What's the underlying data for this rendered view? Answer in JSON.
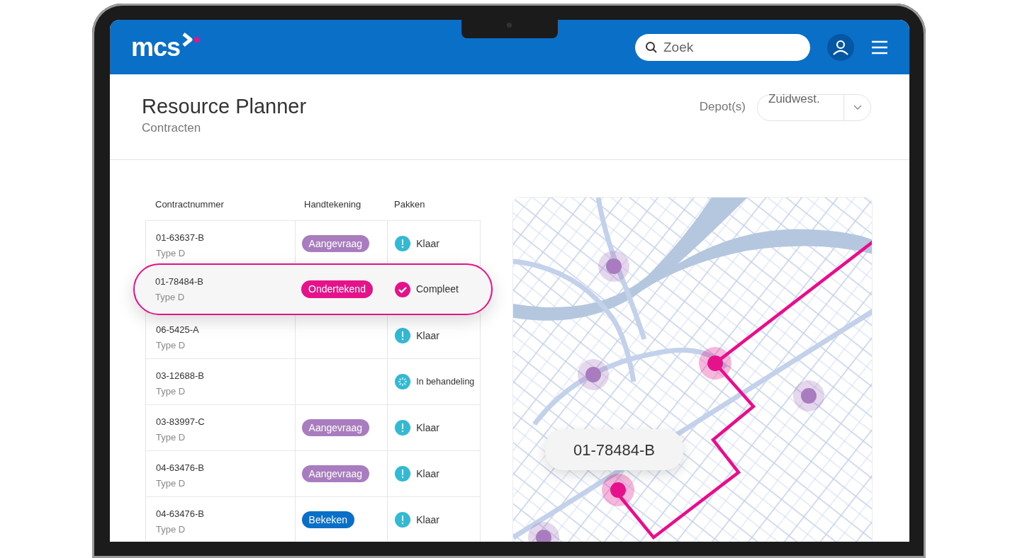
{
  "header": {
    "logo": "mcs",
    "search": {
      "placeholder": "Zoek"
    }
  },
  "page": {
    "title": "Resource Planner",
    "subtitle": "Contracten",
    "depot_label": "Depot(s)",
    "depot_value": "Zuidwest."
  },
  "table": {
    "columns": [
      "Contractnummer",
      "Handtekening",
      "Pakken"
    ],
    "rows": [
      {
        "contract": "01-63637-B",
        "type": "Type D",
        "signature": {
          "label": "Aangevraag",
          "kind": "requested"
        },
        "status": {
          "label": "Klaar",
          "kind": "ready"
        },
        "selected": false
      },
      {
        "contract": "01-78484-B",
        "type": "Type D",
        "signature": {
          "label": "Ondertekend",
          "kind": "signed"
        },
        "status": {
          "label": "Compleet",
          "kind": "complete"
        },
        "selected": true
      },
      {
        "contract": "06-5425-A",
        "type": "Type D",
        "status": {
          "label": "Klaar",
          "kind": "ready"
        },
        "selected": false
      },
      {
        "contract": "03-12688-B",
        "type": "Type D",
        "status": {
          "label": "In behandeling",
          "kind": "processing"
        },
        "selected": false
      },
      {
        "contract": "03-83997-C",
        "type": "Type D",
        "signature": {
          "label": "Aangevraag",
          "kind": "requested"
        },
        "status": {
          "label": "Klaar",
          "kind": "ready"
        },
        "selected": false
      },
      {
        "contract": "04-63476-B",
        "type": "Type D",
        "signature": {
          "label": "Aangevraag",
          "kind": "requested"
        },
        "status": {
          "label": "Klaar",
          "kind": "ready"
        },
        "selected": false
      },
      {
        "contract": "04-63476-B",
        "type": "Type D",
        "signature": {
          "label": "Bekeken",
          "kind": "viewed"
        },
        "status": {
          "label": "Klaar",
          "kind": "ready"
        },
        "selected": false
      }
    ]
  },
  "map": {
    "label": "01-78484-B"
  }
}
